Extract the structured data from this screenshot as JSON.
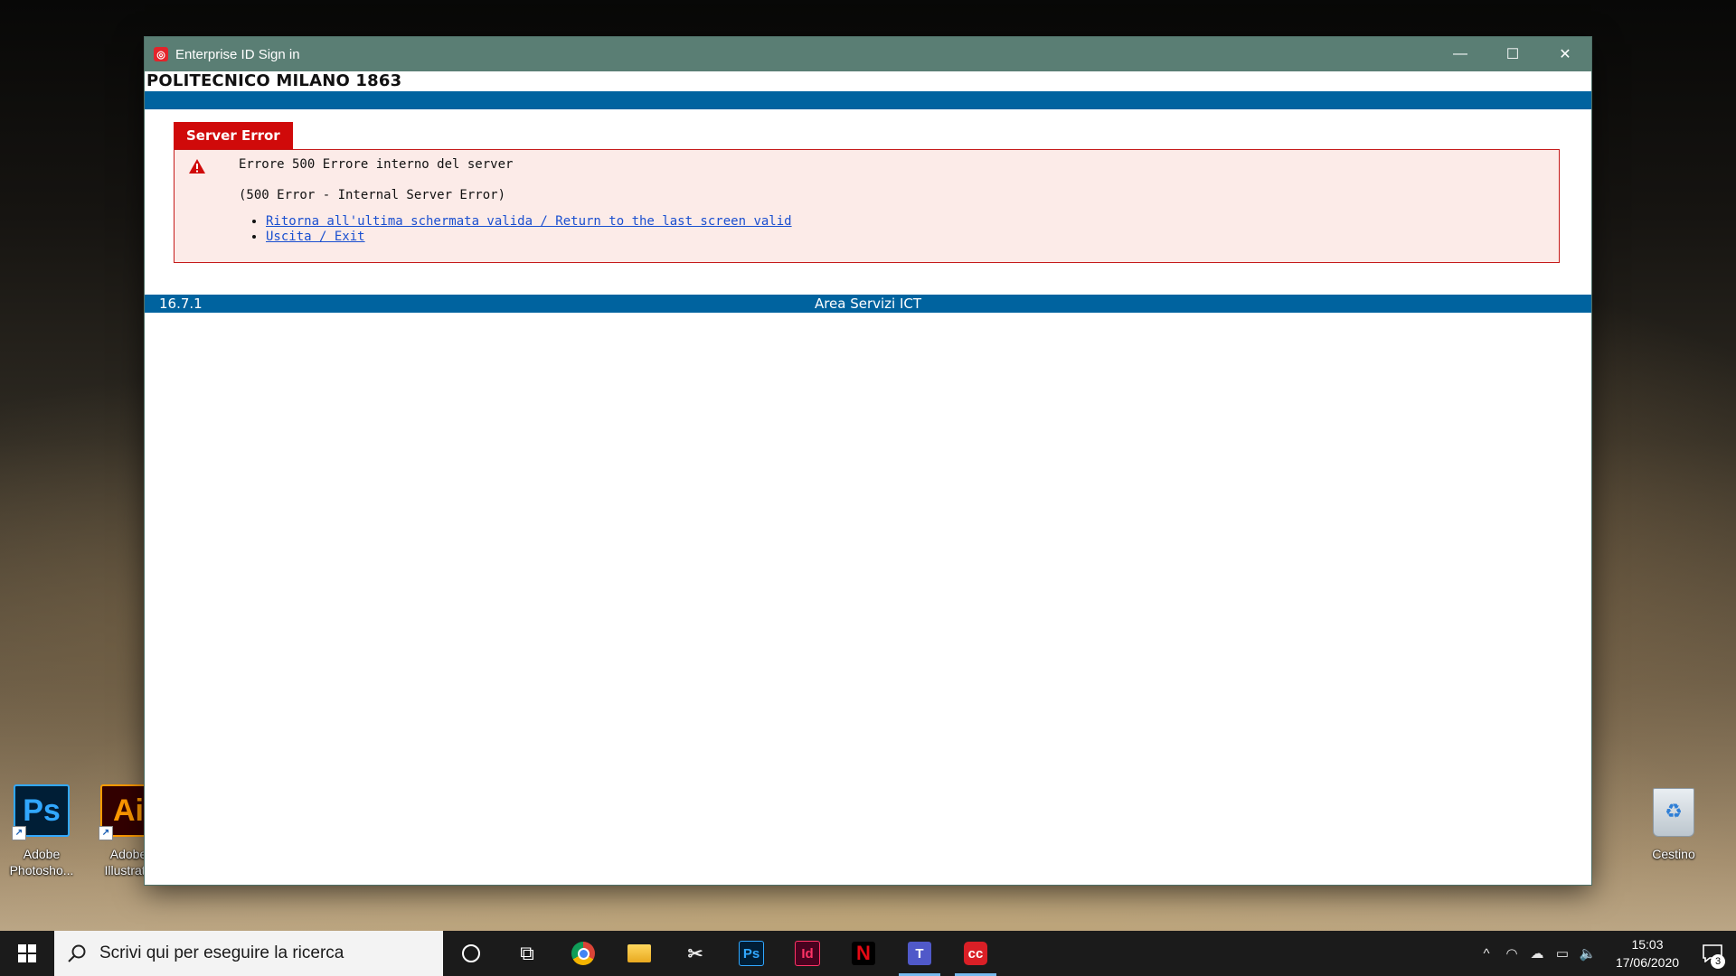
{
  "desktop": {
    "icons": [
      {
        "label_line1": "Adobe",
        "label_line2": "Photosho...",
        "glyph": "Ps"
      },
      {
        "label_line1": "Adobe",
        "label_line2": "Illustrato",
        "glyph": "Ai"
      }
    ],
    "recycle_bin": {
      "label": "Cestino"
    }
  },
  "window": {
    "title": "Enterprise ID Sign in",
    "controls": {
      "minimize": "—",
      "maximize": "☐",
      "close": "✕"
    }
  },
  "page": {
    "brand": "POLITECNICO MILANO 1863",
    "error_tab": "Server Error",
    "error_line1": "Errore 500 Errore interno del server",
    "error_line2": "(500 Error - Internal Server Error)",
    "links": [
      "Ritorna all'ultima schermata valida / Return to the last screen valid",
      "Uscita / Exit"
    ],
    "footer": {
      "version": "16.7.1",
      "center": "Area Servizi ICT"
    }
  },
  "taskbar": {
    "search_placeholder": "Scrivi qui per eseguire la ricerca",
    "pinned": [
      {
        "name": "cortana",
        "glyph": ""
      },
      {
        "name": "task-view",
        "glyph": "⧉"
      },
      {
        "name": "chrome",
        "glyph": ""
      },
      {
        "name": "file-explorer",
        "glyph": ""
      },
      {
        "name": "snip-sketch",
        "glyph": "✂"
      },
      {
        "name": "photoshop",
        "glyph": "Ps"
      },
      {
        "name": "indesign",
        "glyph": "Id"
      },
      {
        "name": "netflix",
        "glyph": "N"
      },
      {
        "name": "teams",
        "glyph": "T"
      },
      {
        "name": "creative-cloud",
        "glyph": "cc"
      }
    ],
    "tray": {
      "chevron": "^",
      "network": "◠",
      "cloud": "☁",
      "battery": "▭",
      "volume": "🔈"
    },
    "time": "15:03",
    "date": "17/06/2020",
    "notification_count": "3"
  },
  "colors": {
    "titlebar": "#5a7e74",
    "band": "#00639f",
    "error_red": "#d00a0a",
    "error_bg": "#fcebe8",
    "link": "#1a4fd0"
  }
}
